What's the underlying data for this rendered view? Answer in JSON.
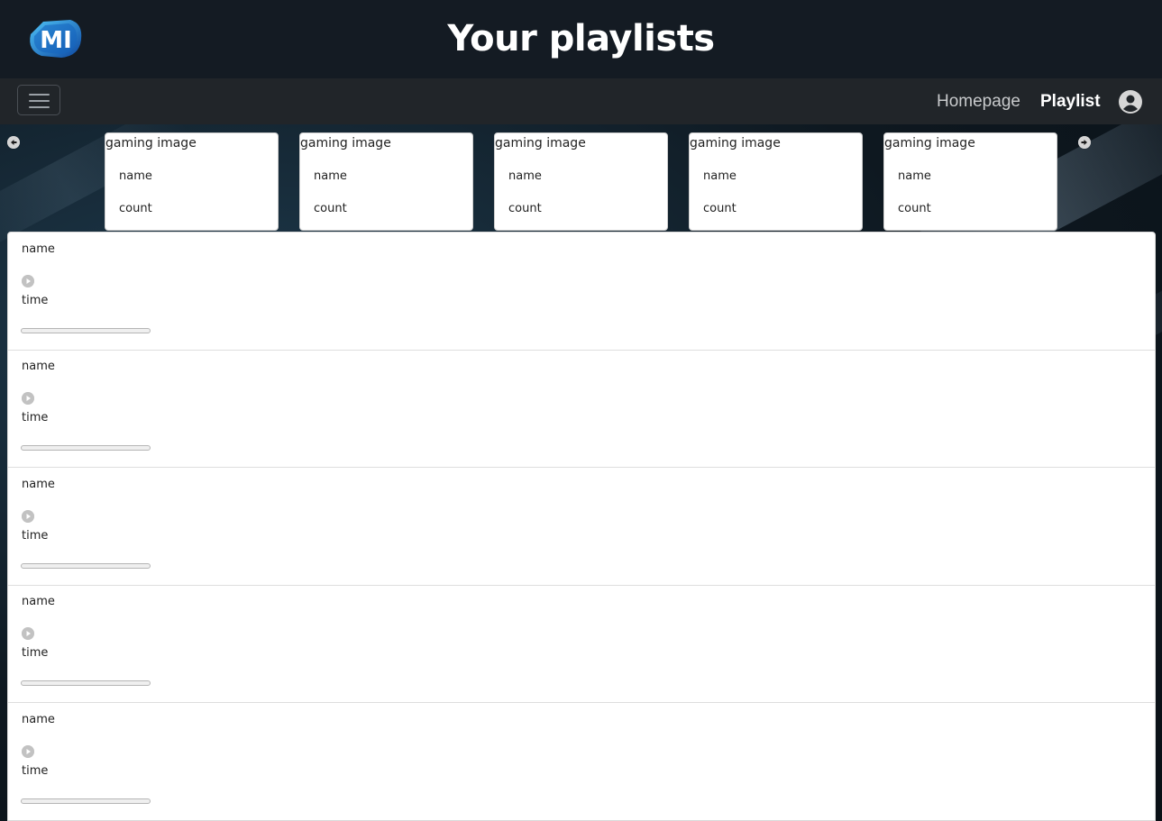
{
  "header": {
    "title": "Your playlists",
    "logo": {
      "text": "MI",
      "icon": "mi-logo"
    }
  },
  "navbar": {
    "menu_icon": "hamburger-icon",
    "links": [
      {
        "label": "Homepage",
        "active": false
      },
      {
        "label": "Playlist",
        "active": true
      }
    ],
    "user_icon": "user-circle-icon"
  },
  "carousel": {
    "prev_icon": "arrow-left-icon",
    "next_icon": "arrow-right-icon",
    "cards": [
      {
        "image_alt": "gaming image",
        "name": "name",
        "count": "count"
      },
      {
        "image_alt": "gaming image",
        "name": "name",
        "count": "count"
      },
      {
        "image_alt": "gaming image",
        "name": "name",
        "count": "count"
      },
      {
        "image_alt": "gaming image",
        "name": "name",
        "count": "count"
      },
      {
        "image_alt": "gaming image",
        "name": "name",
        "count": "count"
      }
    ]
  },
  "tracks": [
    {
      "name": "name",
      "time": "time",
      "progress": 0
    },
    {
      "name": "name",
      "time": "time",
      "progress": 0
    },
    {
      "name": "name",
      "time": "time",
      "progress": 0
    },
    {
      "name": "name",
      "time": "time",
      "progress": 0
    },
    {
      "name": "name",
      "time": "time",
      "progress": 0
    }
  ],
  "colors": {
    "header_bg": "#141b23",
    "navbar_bg": "#212529",
    "logo_blue": "#1e8fd6"
  }
}
